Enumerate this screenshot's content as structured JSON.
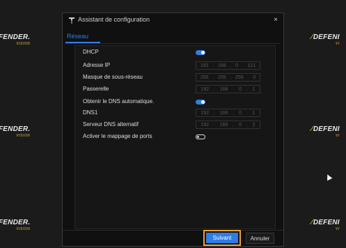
{
  "watermark": {
    "brand": "FENDER.",
    "brand_right": "DEFENI",
    "sub": "VISION",
    "sub_right": "VI"
  },
  "dialog": {
    "title": "Assistant de configuration",
    "close_label": "×",
    "tab": "Réseau"
  },
  "fields": [
    {
      "label": "DHCP",
      "type": "toggle",
      "state": "on"
    },
    {
      "label": "Adresse IP",
      "type": "ip",
      "octets": [
        "192",
        "168",
        "0",
        "121"
      ]
    },
    {
      "label": "Masque de sous-réseau",
      "type": "ip",
      "octets": [
        "255",
        "255",
        "255",
        "0"
      ]
    },
    {
      "label": "Passerelle",
      "type": "ip",
      "octets": [
        "192",
        "168",
        "0",
        "1"
      ]
    },
    {
      "label": "Obtenir le DNS automatique.",
      "type": "toggle",
      "state": "on"
    },
    {
      "label": "DNS1",
      "type": "ip",
      "octets": [
        "192",
        "168",
        "0",
        "1"
      ]
    },
    {
      "label": "Serveur DNS alternatif",
      "type": "ip",
      "octets": [
        "192",
        "168",
        "0",
        "2"
      ]
    },
    {
      "label": "Activer le mappage de ports",
      "type": "toggle",
      "state": "off"
    }
  ],
  "buttons": {
    "next": "Suivant",
    "cancel": "Annuler"
  },
  "colors": {
    "accent": "#2f7de8",
    "focus": "#f0a030"
  },
  "icons": {
    "title": "wizard-icon",
    "close": "close-icon"
  }
}
